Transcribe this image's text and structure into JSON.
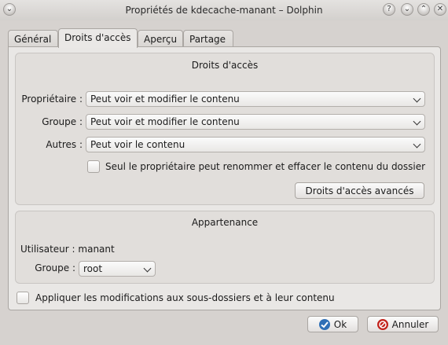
{
  "window": {
    "title": "Propriétés de kdecache-manant – Dolphin",
    "left_icon": "collapse-chevron-icon",
    "right_icons": [
      "help-icon",
      "minimize-icon",
      "maximize-icon",
      "close-icon"
    ]
  },
  "tabs": [
    {
      "label": "Général",
      "active": false
    },
    {
      "label": "Droits d'accès",
      "active": true
    },
    {
      "label": "Aperçu",
      "active": false
    },
    {
      "label": "Partage",
      "active": false
    }
  ],
  "permissions": {
    "title": "Droits d'accès",
    "owner_label": "Propriétaire :",
    "owner_value": "Peut voir et modifier le contenu",
    "group_label": "Groupe :",
    "group_value": "Peut voir et modifier le contenu",
    "others_label": "Autres :",
    "others_value": "Peut voir le contenu",
    "only_owner_checkbox": "Seul le propriétaire peut renommer et effacer le contenu du dossier",
    "advanced_button": "Droits d'accès avancés"
  },
  "ownership": {
    "title": "Appartenance",
    "user_text": "Utilisateur : manant",
    "group_label": "Groupe :",
    "group_value": "root"
  },
  "apply_recursive_checkbox": "Appliquer les modifications aux sous-dossiers et à leur contenu",
  "buttons": {
    "ok": "Ok",
    "cancel": "Annuler"
  },
  "colors": {
    "ok_icon": "#2f6fb6",
    "cancel_icon": "#c2221b"
  }
}
